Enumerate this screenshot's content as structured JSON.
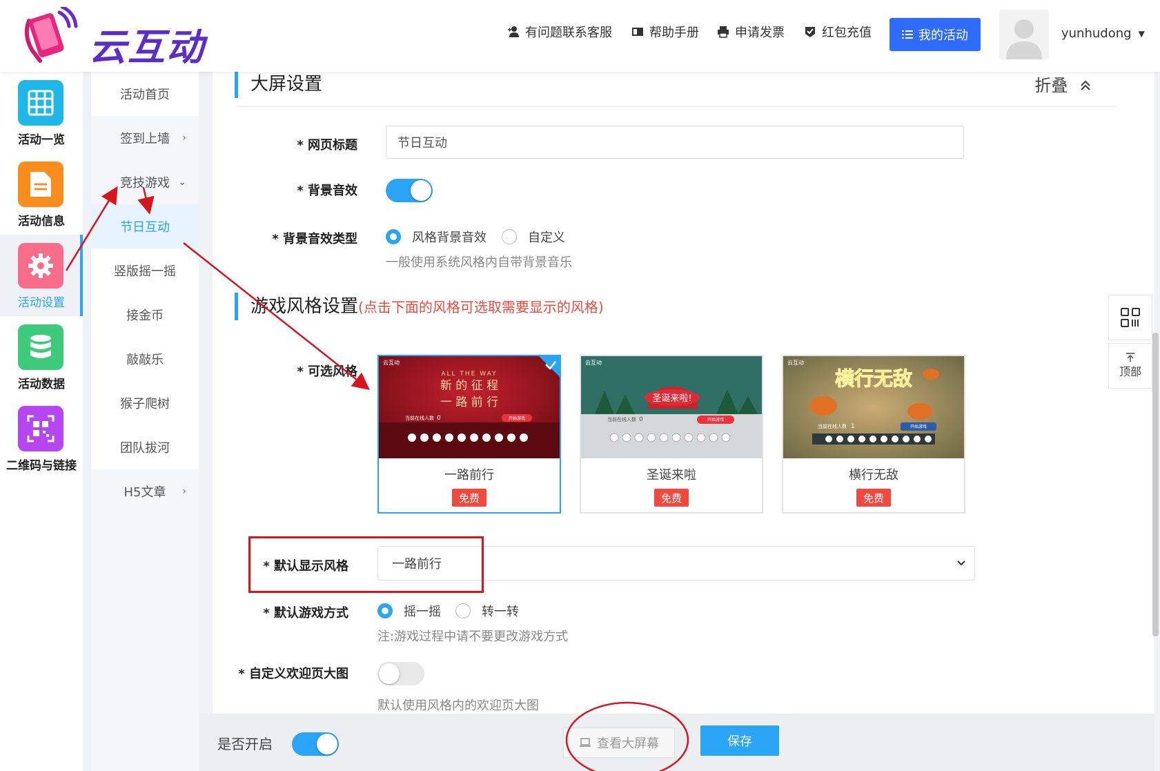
{
  "header": {
    "logo_text": "云互动",
    "nav": [
      {
        "label": "有问题联系客服",
        "icon": "add-user-icon"
      },
      {
        "label": "帮助手册",
        "icon": "book-icon"
      },
      {
        "label": "申请发票",
        "icon": "printer-icon"
      },
      {
        "label": "红包充值",
        "icon": "shield-check-icon"
      }
    ],
    "my_activity": "我的活动",
    "username": "yunhudong"
  },
  "left_sidebar": [
    {
      "label": "活动一览",
      "icon": "grid-icon",
      "color": "#1fb6e8"
    },
    {
      "label": "活动信息",
      "icon": "document-icon",
      "color": "#fb8c1e"
    },
    {
      "label": "活动设置",
      "icon": "gear-icon",
      "color": "#f76d8a"
    },
    {
      "label": "活动数据",
      "icon": "database-icon",
      "color": "#3dca7a"
    },
    {
      "label": "二维码与链接",
      "icon": "qrcode-icon",
      "color": "#b546f2"
    }
  ],
  "sub_sidebar": [
    {
      "label": "活动首页"
    },
    {
      "label": "签到上墙"
    },
    {
      "label": "竞技游戏"
    },
    {
      "label": "节日互动"
    },
    {
      "label": "竖版摇一摇"
    },
    {
      "label": "接金币"
    },
    {
      "label": "敲敲乐"
    },
    {
      "label": "猴子爬树"
    },
    {
      "label": "团队拔河"
    },
    {
      "label": "H5文章"
    }
  ],
  "screen_settings": {
    "title": "大屏设置",
    "fold": "折叠",
    "page_title_label": "* 网页标题",
    "page_title_value": "节日互动",
    "bgm_label": "* 背景音效",
    "bgm_type_label": "* 背景音效类型",
    "bgm_type_options": [
      "风格背景音效",
      "自定义"
    ],
    "bgm_type_hint": "一般使用系统风格内自带背景音乐"
  },
  "game_style": {
    "title": "游戏风格设置",
    "note": "(点击下面的风格可选取需要显示的风格)",
    "styles_label": "* 可选风格",
    "styles": [
      {
        "name": "一路前行",
        "badge": "免费",
        "brand": "云互动",
        "line1": "ALL THE WAY",
        "line2": "新 的 征 程",
        "line3": "一 路 前 行",
        "online": "当前在线人数",
        "count": "0",
        "start": "开始游戏"
      },
      {
        "name": "圣诞来啦",
        "badge": "免费",
        "brand": "云互动",
        "banner": "圣诞来啦!",
        "online": "当前在线人数",
        "count": "0",
        "start": "开始游戏"
      },
      {
        "name": "横行无敌",
        "badge": "免费",
        "brand": "云互动",
        "banner": "横行无敌",
        "online": "当前在线人数",
        "count": "1",
        "start": "开始游戏"
      }
    ],
    "default_style_label": "* 默认显示风格",
    "default_style_value": "一路前行",
    "game_mode_label": "* 默认游戏方式",
    "game_mode_options": [
      "摇一摇",
      "转一转"
    ],
    "game_mode_hint": "注:游戏过程中请不要更改游戏方式",
    "welcome_label": "* 自定义欢迎页大图",
    "welcome_hint": "默认使用风格内的欢迎页大图"
  },
  "bottom": {
    "enable_label": "是否开启",
    "view_screen": "查看大屏幕",
    "save": "保存"
  },
  "right_float": {
    "top_label": "顶部"
  }
}
